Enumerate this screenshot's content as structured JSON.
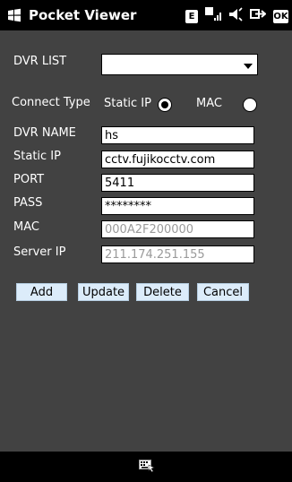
{
  "titlebar": {
    "title": "Pocket Viewer",
    "status": {
      "e_label": "E",
      "signal_label": "E",
      "close_label": "OK"
    }
  },
  "form": {
    "dvr_list": {
      "label": "DVR LIST",
      "value": ""
    },
    "connect_type": {
      "label": "Connect Type",
      "option_static": "Static IP",
      "option_mac": "MAC",
      "selected": "Static IP"
    },
    "dvr_name": {
      "label": "DVR NAME",
      "value": "hs"
    },
    "static_ip": {
      "label": "Static IP",
      "value": "cctv.fujikocctv.com"
    },
    "port": {
      "label": "PORT",
      "value": "5411"
    },
    "pass": {
      "label": "PASS",
      "value": "********"
    },
    "mac": {
      "label": "MAC",
      "value": "000A2F200000"
    },
    "server_ip": {
      "label": "Server IP",
      "value": "211.174.251.155"
    }
  },
  "buttons": {
    "add": "Add",
    "update": "Update",
    "delete": "Delete",
    "cancel": "Cancel"
  },
  "colors": {
    "background": "#424242",
    "button": "#dcecfa",
    "bar": "#000000"
  }
}
